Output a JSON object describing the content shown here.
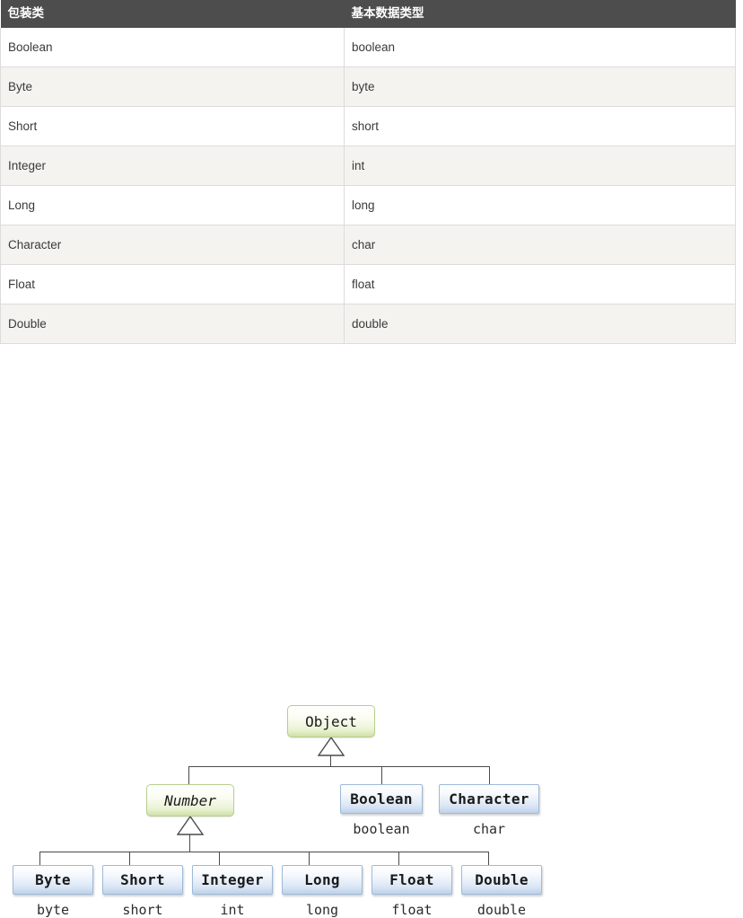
{
  "table": {
    "columns": [
      "包装类",
      "基本数据类型"
    ],
    "rows": [
      {
        "wrapper": "Boolean",
        "primitive": "boolean"
      },
      {
        "wrapper": "Byte",
        "primitive": "byte"
      },
      {
        "wrapper": "Short",
        "primitive": "short"
      },
      {
        "wrapper": "Integer",
        "primitive": "int"
      },
      {
        "wrapper": "Long",
        "primitive": "long"
      },
      {
        "wrapper": "Character",
        "primitive": "char"
      },
      {
        "wrapper": "Float",
        "primitive": "float"
      },
      {
        "wrapper": "Double",
        "primitive": "double"
      }
    ]
  },
  "diagram": {
    "root": {
      "label": "Object"
    },
    "number": {
      "label": "Number"
    },
    "boolean_box": {
      "label": "Boolean",
      "primitive": "boolean"
    },
    "character_box": {
      "label": "Character",
      "primitive": "char"
    },
    "numbers": [
      {
        "label": "Byte",
        "primitive": "byte"
      },
      {
        "label": "Short",
        "primitive": "short"
      },
      {
        "label": "Integer",
        "primitive": "int"
      },
      {
        "label": "Long",
        "primitive": "long"
      },
      {
        "label": "Float",
        "primitive": "float"
      },
      {
        "label": "Double",
        "primitive": "double"
      }
    ]
  },
  "colors": {
    "header_bg": "#4d4d4d",
    "row_alt_bg": "#f4f3ef",
    "table_border": "#dcdcdc",
    "green_border": "#b7cf8e",
    "blue_border": "#9fbad9",
    "connector": "#4a4a4a"
  }
}
